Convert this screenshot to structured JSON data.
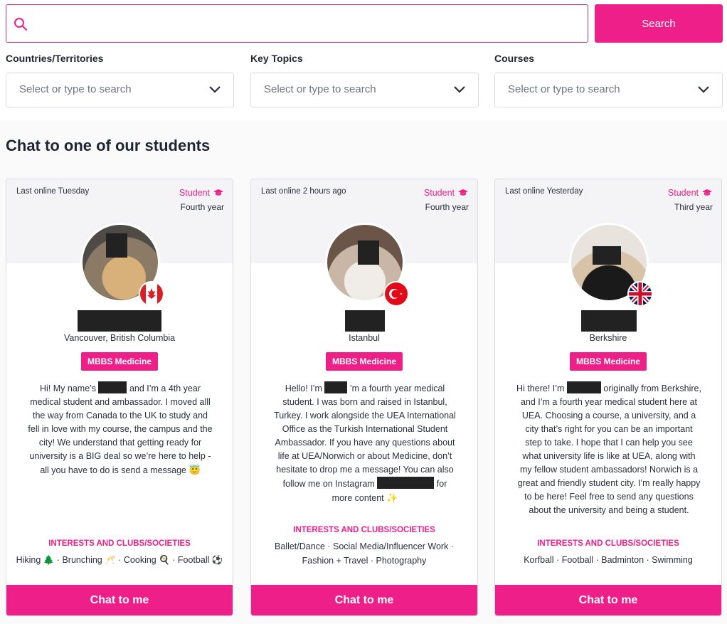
{
  "search": {
    "placeholder": "",
    "button_label": "Search"
  },
  "filters": [
    {
      "label": "Countries/Territories",
      "placeholder": "Select or type to search"
    },
    {
      "label": "Key Topics",
      "placeholder": "Select or type to search"
    },
    {
      "label": "Courses",
      "placeholder": "Select or type to search"
    }
  ],
  "section_title": "Chat to one of our students",
  "cards": [
    {
      "last_online": "Last online Tuesday",
      "role": "Student",
      "year": "Fourth year",
      "location": "Vancouver, British Columbia",
      "course": "MBBS Medicine",
      "bio_a": "Hi! My name’s",
      "bio_b": "and I’m a 4th year medical student and ambassador. I moved alll the way from Canada to the UK to study and fell in love with my course, the campus and the city! We understand that getting ready for university is a BIG deal so we’re here to help - all you have to do is send a message",
      "bio_emoji": "😇",
      "interests_label": "INTERESTS AND CLUBS/SOCIETIES",
      "interests": "Hiking 🌲 · Brunching 🥂 · Cooking 🍳 · Football ⚽",
      "chat_label": "Chat to me",
      "flag": "canada-flag"
    },
    {
      "last_online": "Last online 2 hours ago",
      "role": "Student",
      "year": "Fourth year",
      "location": "Istanbul",
      "course": "MBBS Medicine",
      "bio_a": "Hello! I’m",
      "bio_b": "’m a fourth year medical student. I was born and raised in Istanbul, Turkey. I work alongside the UEA International Office as the Turkish International Student Ambassador. If you have any questions about life at UEA/Norwich or about Medicine, don’t hesitate to drop me a message! You can also follow me on Instagram",
      "bio_c": "for more content",
      "bio_emoji": "✨",
      "interests_label": "INTERESTS AND CLUBS/SOCIETIES",
      "interests": "Ballet/Dance · Social Media/Influencer Work · Fashion + Travel · Photography",
      "chat_label": "Chat to me",
      "flag": "turkey-flag"
    },
    {
      "last_online": "Last online Yesterday",
      "role": "Student",
      "year": "Third year",
      "location": "Berkshire",
      "course": "MBBS Medicine",
      "bio_a": "Hi there! I’m",
      "bio_b": "originally from Berkshire, and I’m a fourth year medical student here at UEA. Choosing a course, a university, and a city that’s right for you can be an important step to take. I hope that I can help you see what university life is like at UEA, along with my fellow student ambassadors! Norwich is a great and friendly student city. I’m really happy to be here! Feel free to send any questions about the university and being a student.",
      "interests_label": "INTERESTS AND CLUBS/SOCIETIES",
      "interests": "Korfball · Football · Badminton · Swimming",
      "chat_label": "Chat to me",
      "flag": "uk-flag"
    }
  ]
}
